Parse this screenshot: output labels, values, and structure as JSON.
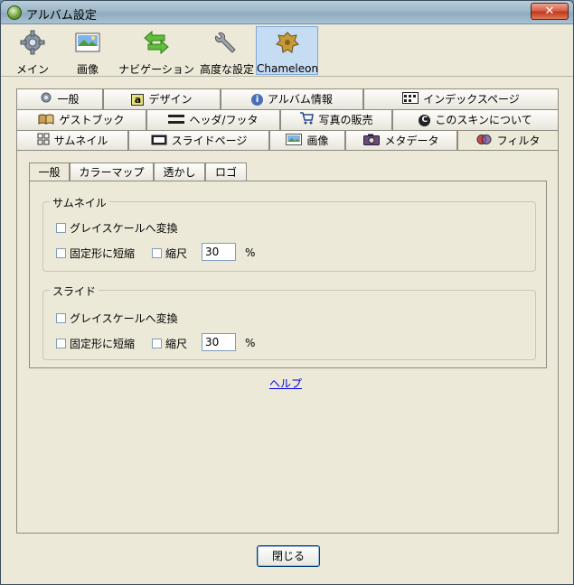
{
  "window": {
    "title": "アルバム設定",
    "close_glyph": "✕"
  },
  "toolbar": {
    "items": [
      {
        "label": "メイン",
        "icon": "gear-icon"
      },
      {
        "label": "画像",
        "icon": "image-icon"
      },
      {
        "label": "ナビゲーション",
        "icon": "arrows-icon"
      },
      {
        "label": "高度な設定",
        "icon": "wrench-icon"
      },
      {
        "label": "Chameleon",
        "icon": "chameleon-icon"
      }
    ],
    "selected": "Chameleon"
  },
  "tabs": {
    "row1": [
      {
        "label": "一般",
        "icon": "gear-icon"
      },
      {
        "label": "デザイン",
        "icon": "letter-a-icon",
        "icon_glyph": "a"
      },
      {
        "label": "アルバム情報",
        "icon": "info-icon",
        "icon_glyph": "i"
      },
      {
        "label": "インデックスページ",
        "icon": "index-page-icon"
      }
    ],
    "row2": [
      {
        "label": "ゲストブック",
        "icon": "book-icon"
      },
      {
        "label": "ヘッダ/フッタ",
        "icon": "header-footer-icon"
      },
      {
        "label": "写真の販売",
        "icon": "cart-icon"
      },
      {
        "label": "このスキンについて",
        "icon": "copyright-icon",
        "icon_glyph": "C"
      }
    ],
    "row3": [
      {
        "label": "サムネイル",
        "icon": "grid-icon"
      },
      {
        "label": "スライドページ",
        "icon": "slide-icon"
      },
      {
        "label": "画像",
        "icon": "image-icon"
      },
      {
        "label": "メタデータ",
        "icon": "camera-icon"
      },
      {
        "label": "フィルタ",
        "icon": "filter-icon"
      }
    ],
    "active": "フィルタ"
  },
  "subtabs": {
    "items": [
      "一般",
      "カラーマップ",
      "透かし",
      "ロゴ"
    ],
    "active": "一般"
  },
  "thumbnail_group": {
    "title": "サムネイル",
    "grayscale_label": "グレイスケールへ変換",
    "fixed_shape_label": "固定形に短縮",
    "scale_label": "縮尺",
    "scale_value": "30",
    "unit": "%"
  },
  "slide_group": {
    "title": "スライド",
    "grayscale_label": "グレイスケールへ変換",
    "fixed_shape_label": "固定形に短縮",
    "scale_label": "縮尺",
    "scale_value": "30",
    "unit": "%"
  },
  "help_link": "ヘルプ",
  "close_button": "閉じる"
}
